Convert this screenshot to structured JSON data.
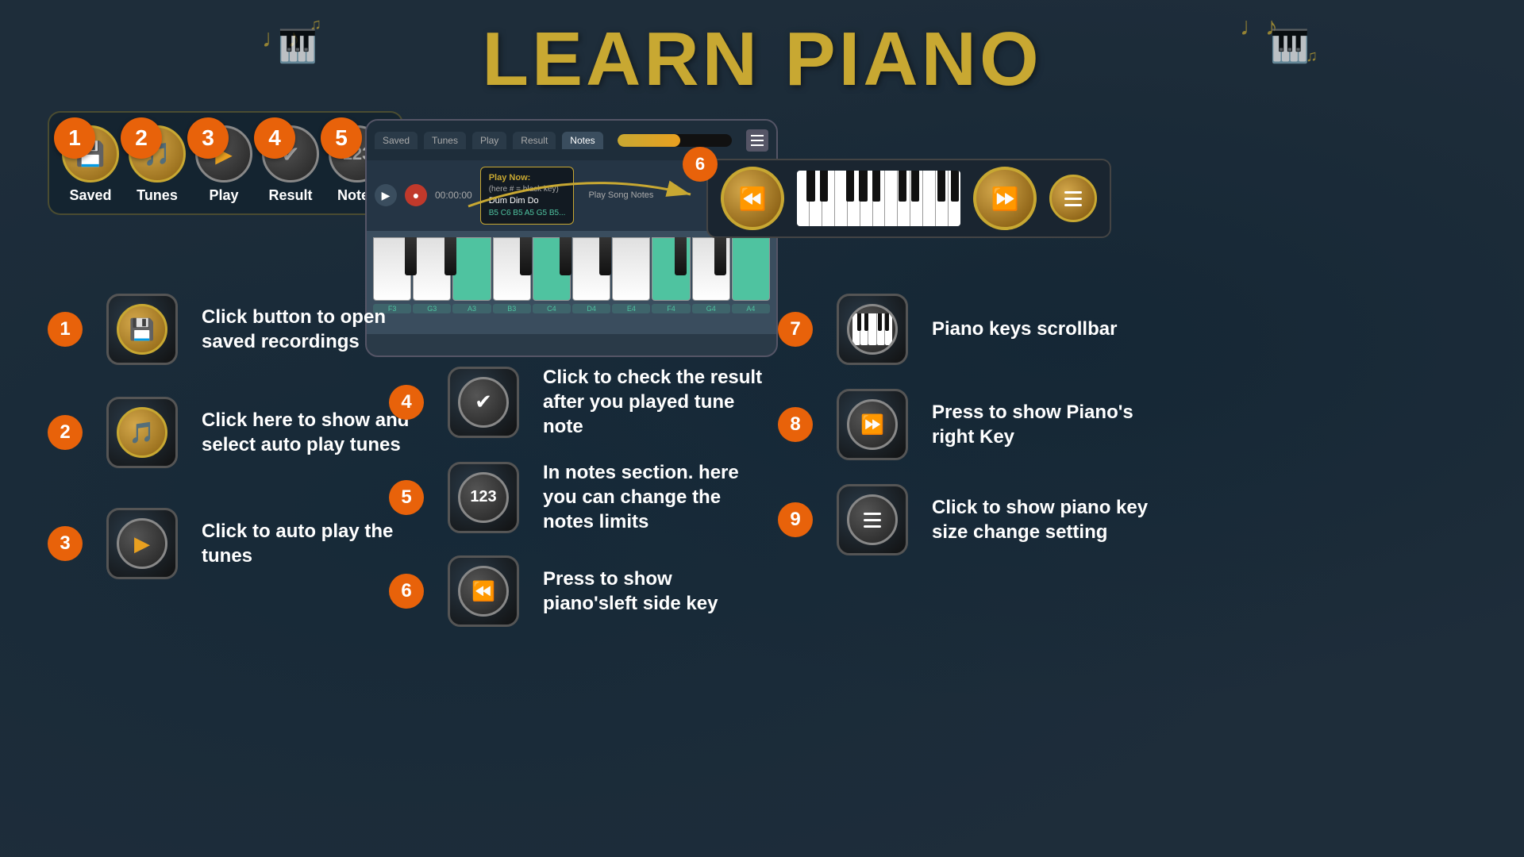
{
  "title": "LEARN PIANO",
  "toolbar": {
    "items": [
      {
        "id": 1,
        "label": "Saved",
        "icon": "save-icon"
      },
      {
        "id": 2,
        "label": "Tunes",
        "icon": "tunes-icon"
      },
      {
        "id": 3,
        "label": "Play",
        "icon": "play-icon"
      },
      {
        "id": 4,
        "label": "Result",
        "icon": "result-icon"
      },
      {
        "id": 5,
        "label": "Notes",
        "icon": "notes-icon"
      }
    ]
  },
  "piano_app": {
    "tabs": [
      "Saved",
      "Tunes",
      "Play",
      "Result",
      "Notes"
    ],
    "play_now_label": "Play Now:",
    "play_now_note": "(here # = black key)",
    "song_name": "Dum Dim Do",
    "notes_text": "B5  C6  B5  A5  G5  B5...",
    "section_label": "Play Song Notes",
    "time": "00:00:00",
    "key_labels": [
      "F3",
      "G3",
      "A3",
      "B3",
      "C4",
      "D4",
      "E4",
      "F4",
      "G4",
      "A4"
    ]
  },
  "instructions": {
    "left": [
      {
        "step": "1",
        "text": "Click button to open saved recordings"
      },
      {
        "step": "2",
        "text": "Click here to show and select  auto play tunes"
      },
      {
        "step": "3",
        "text": "Click to auto play the tunes"
      }
    ],
    "mid": [
      {
        "step": "4",
        "text": "Click to check the result after you played tune note"
      },
      {
        "step": "5",
        "text": "In notes section. here you can change the notes limits"
      },
      {
        "step": "6",
        "text": "Press to show piano'sleft side key"
      }
    ],
    "right": [
      {
        "step": "7",
        "text": "Piano keys scrollbar"
      },
      {
        "step": "8",
        "text": "Press to show Piano's right Key"
      },
      {
        "step": "9",
        "text": "Click to show  piano key size change setting"
      }
    ]
  }
}
